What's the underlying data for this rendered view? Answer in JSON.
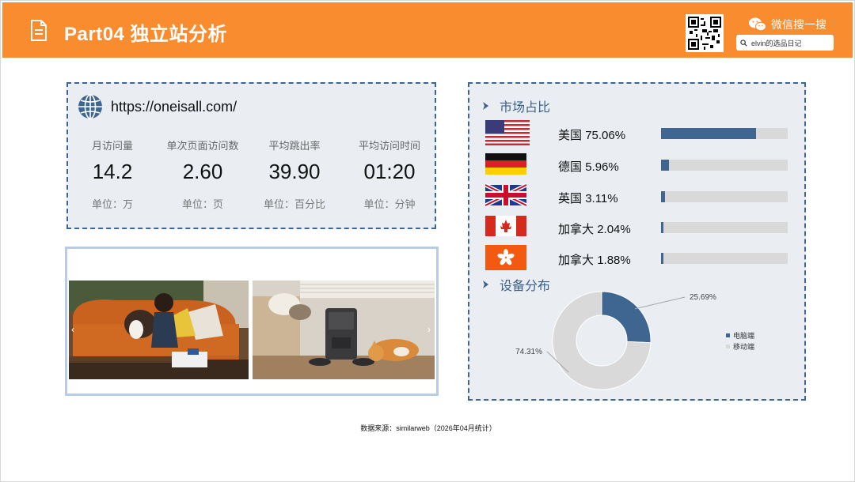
{
  "header": {
    "title": "Part04 独立站分析",
    "wechat_label": "微信搜一搜",
    "search_value": "elvin的选品日记"
  },
  "site": {
    "url": "https://oneisall.com/",
    "metrics": [
      {
        "label": "月访问量",
        "value": "14.2",
        "unit": "单位：万"
      },
      {
        "label": "单次页面访问数",
        "value": "2.60",
        "unit": "单位：页"
      },
      {
        "label": "平均跳出率",
        "value": "39.90",
        "unit": "单位：百分比"
      },
      {
        "label": "平均访问时间",
        "value": "01:20",
        "unit": "单位：分钟"
      }
    ]
  },
  "market": {
    "title": "市场占比",
    "rows": [
      {
        "country": "美国",
        "pct": "75.06%",
        "share": 75.06,
        "flag": "us-flag"
      },
      {
        "country": "德国",
        "pct": "5.96%",
        "share": 5.96,
        "flag": "de-flag"
      },
      {
        "country": "英国",
        "pct": "3.11%",
        "share": 3.11,
        "flag": "uk-flag"
      },
      {
        "country": "加拿大",
        "pct": "2.04%",
        "share": 2.04,
        "flag": "ca-flag"
      },
      {
        "country": "加拿大",
        "pct": "1.88%",
        "share": 1.88,
        "flag": "hk-flag"
      }
    ]
  },
  "device": {
    "title": "设备分布"
  },
  "chart_data": {
    "type": "pie",
    "categories": [
      "电脑端",
      "移动端"
    ],
    "values": [
      25.69,
      74.31
    ],
    "labels": [
      "25.69%",
      "74.31%"
    ],
    "colors": [
      "#3e6690",
      "#d9d9d9"
    ],
    "legend": "right"
  },
  "carousel": {
    "prev": "‹",
    "next": "›"
  },
  "footer": {
    "source": "数据来源：similarweb（2026年04月统计）"
  },
  "colors": {
    "accent": "#f98c2e",
    "panel_border": "#3e6690",
    "panel_bg": "#eaeef3",
    "bar": "#3e6690",
    "bar_track": "#d9d9d9"
  }
}
